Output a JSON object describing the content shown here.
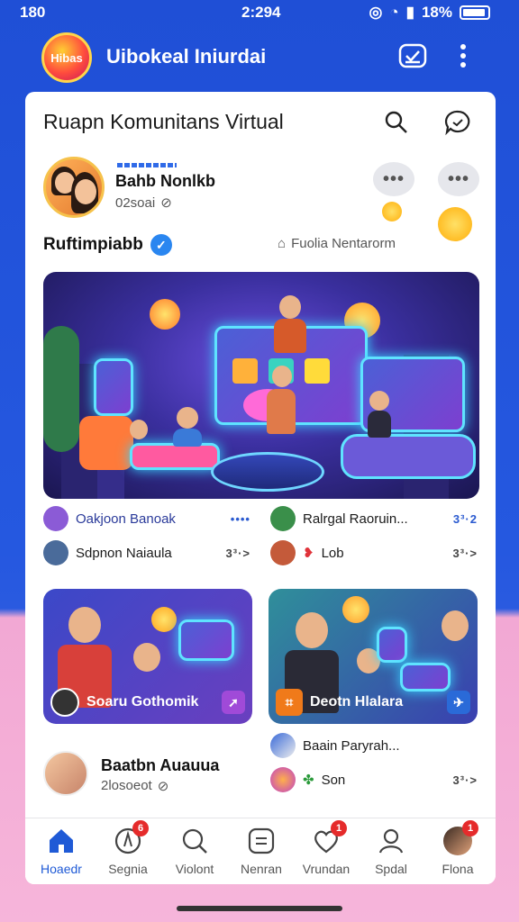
{
  "status_bar": {
    "time_left": "180",
    "time_center": "2:294",
    "battery_text": "18%"
  },
  "header": {
    "logo_text": "Hibas",
    "title": "Uibokeal Iniurdai"
  },
  "page": {
    "title": "Ruapn Komunitans Virtual"
  },
  "profile": {
    "name": "Bahb Nonlkb",
    "subtitle": "02soai"
  },
  "section": {
    "title": "Ruftimpiabb",
    "action": "Fuolia Nentarorm"
  },
  "rows": [
    {
      "label": "Oakjoon Banoak",
      "more": "••••",
      "color": "#8b5bd6"
    },
    {
      "label": "Ralrgal Raoruin...",
      "more": "3³·2",
      "color": "#3a8f4a"
    },
    {
      "label": "Sdpnon Naiaula",
      "more": "3³·>",
      "color": "#4a6b9a"
    },
    {
      "label": "Lob",
      "more": "3³·>",
      "color": "#c45a3a"
    }
  ],
  "cards": [
    {
      "label": "Soaru Gothomik"
    },
    {
      "label": "Deotn Hlalara"
    }
  ],
  "lower_rows": [
    {
      "label": "Baain Paryrah..."
    },
    {
      "label": "Son",
      "more": "3³·>"
    }
  ],
  "post": {
    "name": "Baatbn Auauua",
    "subtitle": "2losoeot"
  },
  "nav": [
    {
      "label": "Hoaedr",
      "icon": "home-icon",
      "active": true
    },
    {
      "label": "Segnia",
      "icon": "compass-icon",
      "badge": "6"
    },
    {
      "label": "Violont",
      "icon": "search-icon"
    },
    {
      "label": "Nenran",
      "icon": "grid-icon"
    },
    {
      "label": "Vrundan",
      "icon": "heart-icon",
      "badge": "1"
    },
    {
      "label": "Spdal",
      "icon": "profile-icon"
    },
    {
      "label": "Flona",
      "icon": "avatar-icon",
      "badge": "1"
    }
  ],
  "colors": {
    "brand_blue": "#2558e0",
    "accent_pink": "#f6b5da",
    "active_nav": "#1f5ad6"
  }
}
